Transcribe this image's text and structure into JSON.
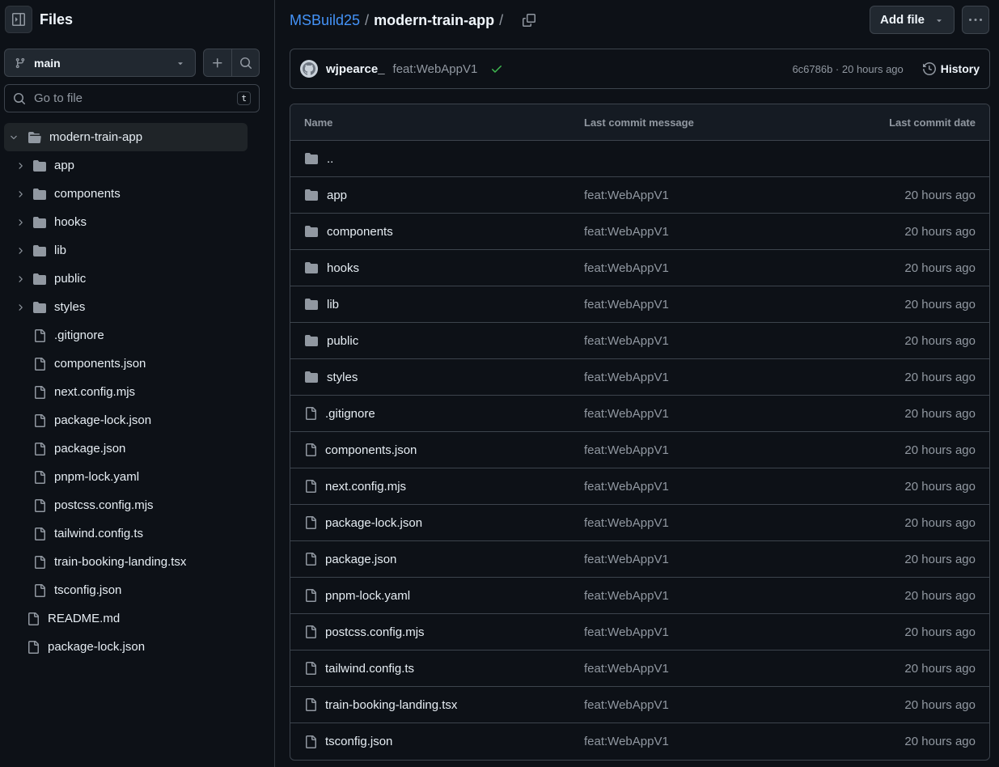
{
  "sidebar": {
    "title": "Files",
    "branch": "main",
    "search_placeholder": "Go to file",
    "search_shortcut": "t",
    "root_folder": "modern-train-app",
    "tree": [
      {
        "label": "app",
        "type": "folder"
      },
      {
        "label": "components",
        "type": "folder"
      },
      {
        "label": "hooks",
        "type": "folder"
      },
      {
        "label": "lib",
        "type": "folder"
      },
      {
        "label": "public",
        "type": "folder"
      },
      {
        "label": "styles",
        "type": "folder"
      },
      {
        "label": ".gitignore",
        "type": "file"
      },
      {
        "label": "components.json",
        "type": "file"
      },
      {
        "label": "next.config.mjs",
        "type": "file"
      },
      {
        "label": "package-lock.json",
        "type": "file"
      },
      {
        "label": "package.json",
        "type": "file"
      },
      {
        "label": "pnpm-lock.yaml",
        "type": "file"
      },
      {
        "label": "postcss.config.mjs",
        "type": "file"
      },
      {
        "label": "tailwind.config.ts",
        "type": "file"
      },
      {
        "label": "train-booking-landing.tsx",
        "type": "file"
      },
      {
        "label": "tsconfig.json",
        "type": "file"
      }
    ],
    "top_level_files": [
      "README.md",
      "package-lock.json"
    ]
  },
  "header": {
    "owner": "MSBuild25",
    "separator": "/",
    "repo": "modern-train-app",
    "trailing_separator": "/",
    "add_file_label": "Add file"
  },
  "commit": {
    "author": "wjpearce_",
    "message": "feat:WebAppV1",
    "meta": "6c6786b · 20 hours ago",
    "history_label": "History"
  },
  "table": {
    "headers": {
      "name": "Name",
      "message": "Last commit message",
      "date": "Last commit date"
    },
    "parent_label": "..",
    "rows": [
      {
        "name": "app",
        "type": "folder",
        "message": "feat:WebAppV1",
        "date": "20 hours ago"
      },
      {
        "name": "components",
        "type": "folder",
        "message": "feat:WebAppV1",
        "date": "20 hours ago"
      },
      {
        "name": "hooks",
        "type": "folder",
        "message": "feat:WebAppV1",
        "date": "20 hours ago"
      },
      {
        "name": "lib",
        "type": "folder",
        "message": "feat:WebAppV1",
        "date": "20 hours ago"
      },
      {
        "name": "public",
        "type": "folder",
        "message": "feat:WebAppV1",
        "date": "20 hours ago"
      },
      {
        "name": "styles",
        "type": "folder",
        "message": "feat:WebAppV1",
        "date": "20 hours ago"
      },
      {
        "name": ".gitignore",
        "type": "file",
        "message": "feat:WebAppV1",
        "date": "20 hours ago"
      },
      {
        "name": "components.json",
        "type": "file",
        "message": "feat:WebAppV1",
        "date": "20 hours ago"
      },
      {
        "name": "next.config.mjs",
        "type": "file",
        "message": "feat:WebAppV1",
        "date": "20 hours ago"
      },
      {
        "name": "package-lock.json",
        "type": "file",
        "message": "feat:WebAppV1",
        "date": "20 hours ago"
      },
      {
        "name": "package.json",
        "type": "file",
        "message": "feat:WebAppV1",
        "date": "20 hours ago"
      },
      {
        "name": "pnpm-lock.yaml",
        "type": "file",
        "message": "feat:WebAppV1",
        "date": "20 hours ago"
      },
      {
        "name": "postcss.config.mjs",
        "type": "file",
        "message": "feat:WebAppV1",
        "date": "20 hours ago"
      },
      {
        "name": "tailwind.config.ts",
        "type": "file",
        "message": "feat:WebAppV1",
        "date": "20 hours ago"
      },
      {
        "name": "train-booking-landing.tsx",
        "type": "file",
        "message": "feat:WebAppV1",
        "date": "20 hours ago"
      },
      {
        "name": "tsconfig.json",
        "type": "file",
        "message": "feat:WebAppV1",
        "date": "20 hours ago"
      }
    ]
  },
  "colors": {
    "link": "#4493f8",
    "success": "#3fb950",
    "muted": "#9198a1",
    "folder": "#9198a1"
  }
}
